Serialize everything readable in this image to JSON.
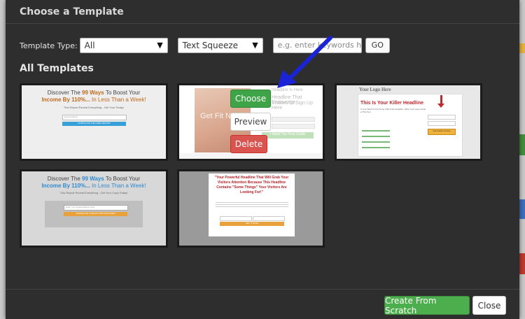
{
  "modal": {
    "title": "Choose a Template"
  },
  "filters": {
    "type_label": "Template Type:",
    "type_value": "All",
    "category_value": "Text Squeeze",
    "keyword_placeholder": "e.g. enter keywords here",
    "go_label": "GO"
  },
  "section_title": "All Templates",
  "thumbs": {
    "t1": {
      "line1a": "Discover The ",
      "line1b": "99 Ways",
      "line1c": " To Boost Your",
      "line2a": "Income By 110%...",
      "line2b": " In Less Than a Week!",
      "sub": "This Report Reveal Everything - Get Your Today!",
      "field": "Email Address",
      "btn": "DOWNLOAD THE FREE REPORT"
    },
    "t2": {
      "hero": "Get Fit N",
      "title": "Headline That Encourage",
      "title2": "Visitors To Sign Up Here",
      "btn": "I Want The Free Guide",
      "top": "Headline Is Here"
    },
    "t3": {
      "logo": "Your Logo Here",
      "headline": "This Is Your Killer Headline",
      "sub": "If Your Want To Put Some Killer Fast Headline, Write Your Copy Inside a This Text",
      "btn": "Get Instant Access"
    },
    "t4": {
      "line1a": "Discover The ",
      "line1b": "99 Ways",
      "line1c": " To Boost Your",
      "line2a": "Income By 110%...",
      "line2b": " In Less Than a Week!",
      "sub": "This Report Reveal Everything - Get Your Copy Today!",
      "field": "Enter Your Email Address Here",
      "btn": "DOWNLOAD IT RIGHT NOW FOR FREE!"
    },
    "t5": {
      "h1": "\"Your Powerful Headline That Will Grab Your",
      "h2": "Visitors Attention Because This Headline",
      "h3": "Contains \"Some Things\" Your Visitors Are",
      "h4": "Looking For!\"",
      "btn": "GET IT NOW!"
    }
  },
  "overlay": {
    "choose": "Choose",
    "preview": "Preview",
    "delete": "Delete"
  },
  "footer": {
    "create": "Create From Scratch",
    "close": "Close"
  },
  "colors": {
    "modal_bg": "#2e2e2e",
    "choose": "#3ea447",
    "delete": "#d9534f",
    "create": "#4cae4c",
    "arrow": "#1a24d6"
  }
}
